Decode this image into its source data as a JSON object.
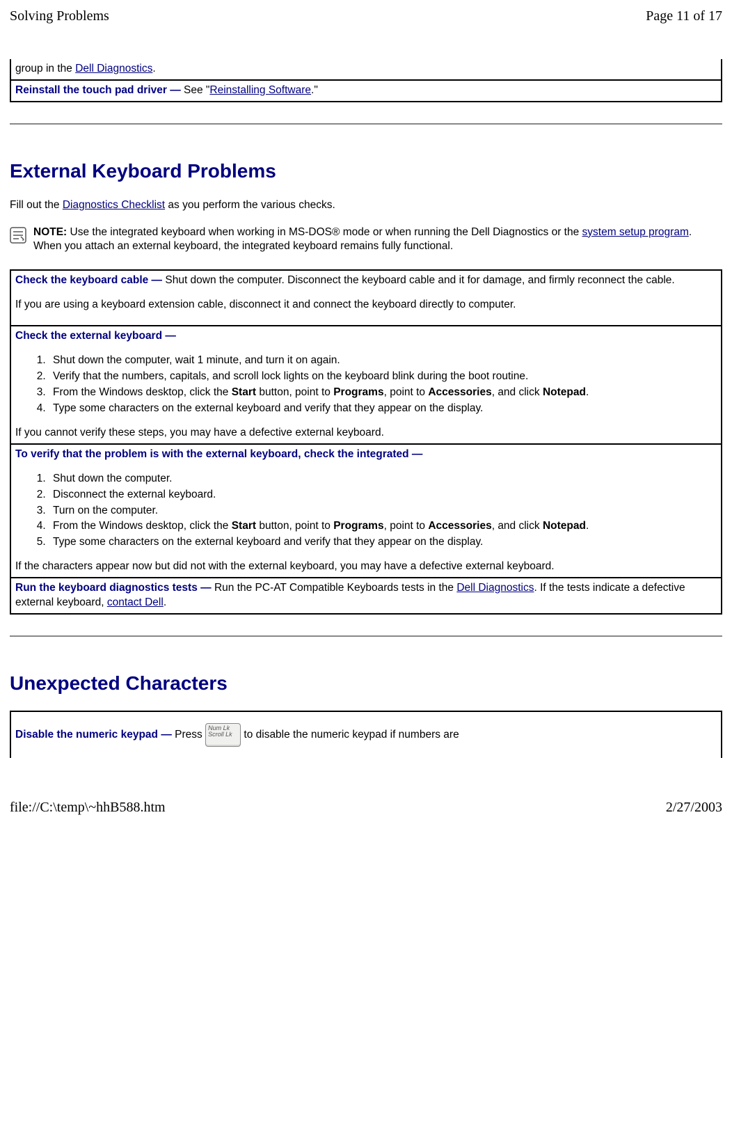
{
  "header": {
    "title": "Solving Problems",
    "page": "Page 11 of 17"
  },
  "frag1": {
    "row1_prefix": "group in the ",
    "row1_link": "Dell Diagnostics",
    "row1_suffix": ".",
    "row2_action": "Reinstall the touch pad driver — ",
    "row2_mid": "See \"",
    "row2_link": "Reinstalling Software",
    "row2_suffix": ".\""
  },
  "section1": {
    "title": "External Keyboard Problems",
    "intro_prefix": "Fill out the ",
    "intro_link": "Diagnostics Checklist",
    "intro_suffix": " as you perform the various checks.",
    "note_label": "NOTE: ",
    "note_a": "Use the integrated keyboard when working in MS-DOS® mode or when running the Dell Diagnostics or the ",
    "note_link": "system setup program",
    "note_b": ". When you attach an external keyboard, the integrated keyboard remains fully functional."
  },
  "table1": {
    "r1_action": "Check the keyboard cable — ",
    "r1_a": "Shut down the computer. Disconnect the keyboard cable and it for damage, and firmly reconnect the cable.",
    "r1_b": "If you are using a keyboard extension cable, disconnect it and connect the keyboard directly to computer.",
    "r2_action": "Check the external keyboard —",
    "r2_steps": [
      "Shut down the computer, wait 1 minute, and turn it on again.",
      "Verify that the numbers, capitals, and scroll lock lights on the keyboard blink during the boot routine.",
      "",
      "Type some characters on the external keyboard and verify that they appear on the display."
    ],
    "r2_s3_a": "From the Windows desktop, click the ",
    "r2_s3_b": "Start",
    "r2_s3_c": " button, point to ",
    "r2_s3_d": "Programs",
    "r2_s3_e": ", point to ",
    "r2_s3_f": "Accessories",
    "r2_s3_g": ", and click ",
    "r2_s3_h": "Notepad",
    "r2_s3_i": ".",
    "r2_out": "If you cannot verify these steps, you may have a defective external keyboard.",
    "r3_action": "To verify that the problem is with the external keyboard, check the integrated —",
    "r3_steps": [
      "Shut down the computer.",
      "Disconnect the external keyboard.",
      "Turn on the computer.",
      "",
      "Type some characters on the external keyboard and verify that they appear on the display."
    ],
    "r3_s4_a": "From the Windows desktop, click the ",
    "r3_s4_b": "Start",
    "r3_s4_c": " button, point to ",
    "r3_s4_d": "Programs",
    "r3_s4_e": ", point to ",
    "r3_s4_f": "Accessories",
    "r3_s4_g": ", and click ",
    "r3_s4_h": "Notepad",
    "r3_s4_i": ".",
    "r3_out": "If the characters appear now but did not with the external keyboard, you may have a defective external keyboard.",
    "r4_action": "Run the keyboard diagnostics tests — ",
    "r4_a": "Run the PC-AT Compatible Keyboards tests in the ",
    "r4_link1": "Dell Diagnostics",
    "r4_b": ". If the tests indicate a defective external keyboard, ",
    "r4_link2": "contact Dell",
    "r4_c": "."
  },
  "section2": {
    "title": "Unexpected Characters",
    "action": "Disable the numeric keypad — ",
    "a": "Press",
    "key1": "Num Lk",
    "key2": "Scroll Lk",
    "b": " to disable the numeric keypad if numbers are"
  },
  "footer": {
    "path": "file://C:\\temp\\~hhB588.htm",
    "date": "2/27/2003"
  }
}
